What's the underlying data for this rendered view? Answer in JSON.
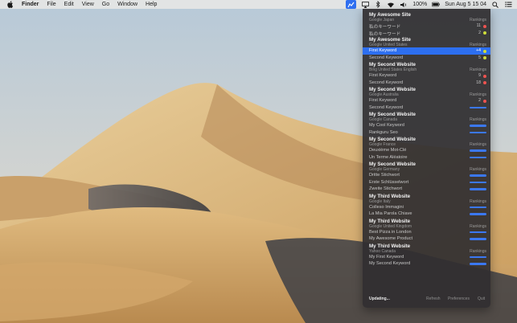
{
  "menubar": {
    "app_name": "Finder",
    "menus": [
      "File",
      "Edit",
      "View",
      "Go",
      "Window",
      "Help"
    ],
    "battery_percent": "100%",
    "datetime": "Sun Aug 5  15 04"
  },
  "panel": {
    "sites": [
      {
        "name": "My Awesome Site",
        "engine": "Google Japan",
        "rank_label": "Rankings",
        "keywords": [
          {
            "label": "私のキーワード",
            "rank": "11",
            "indicator": "red"
          },
          {
            "label": "私のキーワード",
            "rank": "2",
            "indicator": "green"
          }
        ]
      },
      {
        "name": "My Awesome Site",
        "engine": "Google United States",
        "rank_label": "Rankings",
        "keywords": [
          {
            "label": "First Keyword",
            "rank": "+4",
            "indicator": "green",
            "selected": true
          },
          {
            "label": "Second Keyword",
            "rank": "5",
            "indicator": "green"
          }
        ]
      },
      {
        "name": "My Second Website",
        "engine": "Bing United States English",
        "rank_label": "Rankings",
        "keywords": [
          {
            "label": "First Keyword",
            "rank": "9",
            "indicator": "red"
          },
          {
            "label": "Second Keyword",
            "rank": "18",
            "indicator": "red"
          }
        ]
      },
      {
        "name": "My Second Website",
        "engine": "Google Australia",
        "rank_label": "Rankings",
        "keywords": [
          {
            "label": "First Keyword",
            "rank": "2",
            "indicator": "red"
          },
          {
            "label": "Second Keyword",
            "rank": "",
            "indicator": "bar"
          }
        ]
      },
      {
        "name": "My Second Website",
        "engine": "Google Canada",
        "rank_label": "Rankings",
        "keywords": [
          {
            "label": "My Cool Keyword",
            "rank": "",
            "indicator": "bar"
          },
          {
            "label": "Rankguru Seo",
            "rank": "",
            "indicator": "bar"
          }
        ]
      },
      {
        "name": "My Second Website",
        "engine": "Google France",
        "rank_label": "Rankings",
        "keywords": [
          {
            "label": "Deuxième Mot-Clé",
            "rank": "",
            "indicator": "bar"
          },
          {
            "label": "Un Terme Aléatoire",
            "rank": "",
            "indicator": "bar"
          }
        ]
      },
      {
        "name": "My Second Website",
        "engine": "Google Germany",
        "rank_label": "Rankings",
        "keywords": [
          {
            "label": "Dritte Stichwort",
            "rank": "",
            "indicator": "bar"
          },
          {
            "label": "Erste Schlüsselwort",
            "rank": "",
            "indicator": "bar"
          },
          {
            "label": "Zweite Stichwort",
            "rank": "",
            "indicator": "bar"
          }
        ]
      },
      {
        "name": "My Third Website",
        "engine": "Google Italy",
        "rank_label": "Rankings",
        "keywords": [
          {
            "label": "Colleso Immagini",
            "rank": "",
            "indicator": "bar"
          },
          {
            "label": "La Mia Parola Chiave",
            "rank": "",
            "indicator": "bar"
          }
        ]
      },
      {
        "name": "My Third Website",
        "engine": "Google United Kingdom",
        "rank_label": "Rankings",
        "keywords": [
          {
            "label": "Best Pizza in London",
            "rank": "",
            "indicator": "bar"
          },
          {
            "label": "My Awesome Product",
            "rank": "",
            "indicator": "bar"
          }
        ]
      },
      {
        "name": "My Third Website",
        "engine": "Yahoo Canada",
        "rank_label": "Rankings",
        "keywords": [
          {
            "label": "My First Keyword",
            "rank": "",
            "indicator": "bar"
          },
          {
            "label": "My Second Keyword",
            "rank": "",
            "indicator": "bar"
          }
        ]
      }
    ],
    "footer": {
      "status": "Updating...",
      "refresh": "Refresh",
      "preferences": "Preferences",
      "quit": "Quit"
    }
  },
  "colors": {
    "indicator_red": "#ef5350",
    "indicator_green": "#cddc39",
    "selection": "#2d6ff0",
    "progress_bar": "#3b78f2"
  }
}
